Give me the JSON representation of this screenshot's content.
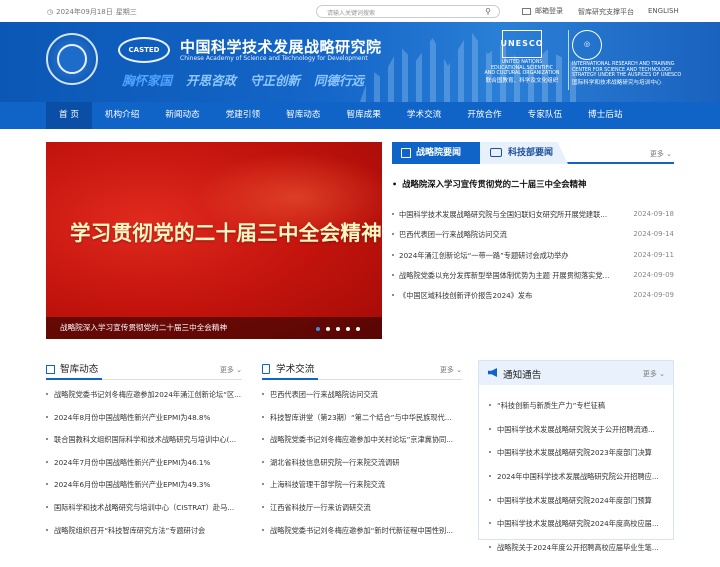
{
  "topbar": {
    "date": "2024年09月18日",
    "weekday": "星期三",
    "search_placeholder": "请输入关键词搜索",
    "mail_login": "邮箱登录",
    "platform": "智库研究支撑平台",
    "english": "ENGLISH"
  },
  "banner": {
    "casted": "CASTED",
    "title_cn": "中国科学技术发展战略研究院",
    "title_en_1": "Chinese Academy of Science and Technology for Development",
    "slogans": [
      "胸怀家国",
      "开思咨政",
      "守正创新",
      "同德行远"
    ],
    "un_text_1": "UNITED NATIONS",
    "un_text_2": "EDUCATIONAL,SCIENTIFIC",
    "un_text_3": "AND CULTURAL ORGANIZATION",
    "un_text_cn": "联合国教育、科学及文化组织",
    "irt_text_1": "INTERNATIONAL RESEARCH AND TRAINING",
    "irt_text_2": "CENTER FOR SCIENCE AND TECHNOLOGY",
    "irt_text_3": "STRATEGY UNDER THE AUSPICES OF UNESCO",
    "irt_text_cn": "国际科学和技术战略研究与培训中心"
  },
  "nav": {
    "items": [
      "首 页",
      "机构介绍",
      "新闻动态",
      "党建引领",
      "智库动态",
      "智库成果",
      "学术交流",
      "开放合作",
      "专家队伍",
      "博士后站"
    ]
  },
  "hero": {
    "title": "学习贯彻党的二十届三中全会精神",
    "caption": "战略院深入学习宣传贯彻党的二十届三中全会精神"
  },
  "news": {
    "tab1": "战略院要闻",
    "tab2": "科技部要闻",
    "more": "更多",
    "headline": "战略院深入学习宣传贯彻党的二十届三中全会精神",
    "items": [
      {
        "title": "中国科学技术发展战略研究院与全国妇联妇女研究所开展党建联...",
        "date": "2024-09-18"
      },
      {
        "title": "巴西代表团一行来战略院访问交流",
        "date": "2024-09-14"
      },
      {
        "title": "2024年涌江创新论坛“一带一路”专题研讨会成功举办",
        "date": "2024-09-11"
      },
      {
        "title": "战略院党委以充分发挥新型举国体制优势为主题 开展贯彻落实党...",
        "date": "2024-09-09"
      },
      {
        "title": "《中国区域科技创新评价报告2024》发布",
        "date": "2024-09-09"
      }
    ]
  },
  "think": {
    "title": "智库动态",
    "more": "更多",
    "items": [
      "战略院党委书记刘冬梅应邀参加2024年涌江创新论坛“区...",
      "2024年8月份中国战略性新兴产业EPMI为48.8%",
      "联合国教科文组织国际科学和技术战略研究与培训中心(...",
      "2024年7月份中国战略性新兴产业EPMI为46.1%",
      "2024年6月份中国战略性新兴产业EPMI为49.3%",
      "国际科学和技术战略研究与培训中心（CISTRAT）赴马...",
      "战略院组织召开“科技智库研究方法”专题研讨会"
    ]
  },
  "academic": {
    "title": "学术交流",
    "more": "更多",
    "items": [
      "巴西代表团一行来战略院访问交流",
      "科技智库讲堂（第23期）“第二个结合”与中华民族现代...",
      "战略院党委书记刘冬梅应邀参加中关村论坛”京津冀协同...",
      "湖北省科技信息研究院一行来院交流调研",
      "上海科技管理干部学院一行来院交流",
      "江西省科技厅一行来访调研交流",
      "战略院党委书记刘冬梅应邀参加“新时代新征程中国性别..."
    ]
  },
  "notice": {
    "title": "通知通告",
    "more": "更多",
    "items": [
      "“科技创新与新质生产力”专栏征稿",
      "中国科学技术发展战略研究院关于公开招聘流通...",
      "中国科学技术发展战略研究院2023年度部门决算",
      "2024年中国科学技术发展战略研究院公开招聘应...",
      "中国科学技术发展战略研究院2024年度部门预算",
      "中国科学技术发展战略研究院2024年度高校应届...",
      "战略院关于2024年度公开招聘高校应届毕业生笔..."
    ]
  },
  "colors": {
    "primary": "#1064c8",
    "nav_active": "#0a4ea6",
    "hero_red": "#c4140d"
  }
}
